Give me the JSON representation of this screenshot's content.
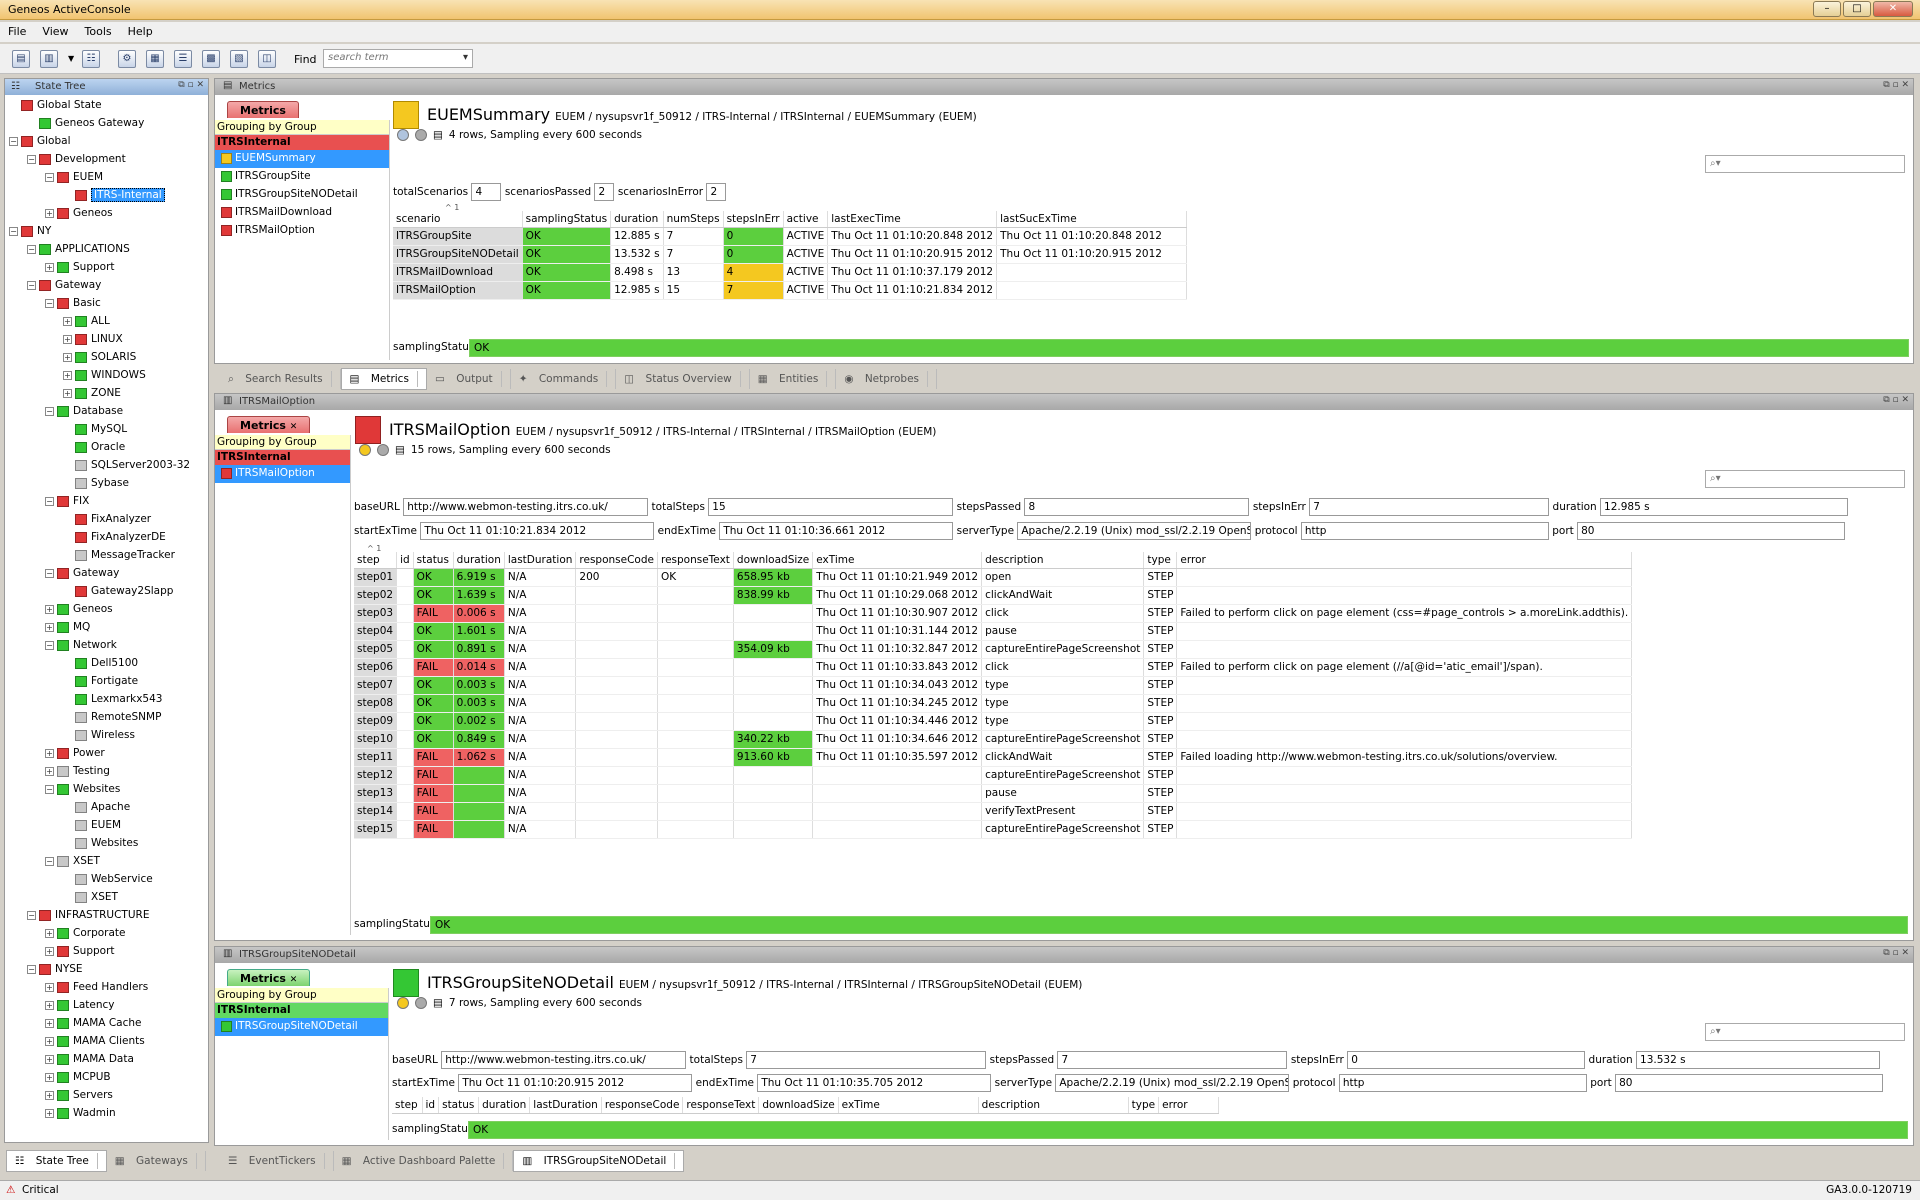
{
  "window": {
    "title": "Geneos ActiveConsole",
    "controls": [
      "–",
      "□",
      "✕"
    ]
  },
  "menu": [
    "File",
    "View",
    "Tools",
    "Help"
  ],
  "toolbar": {
    "find_label": "Find",
    "search_placeholder": "search term"
  },
  "state_tree": {
    "title": "State Tree",
    "nodes": [
      {
        "label": "Global State",
        "level": 0,
        "color": "r",
        "expand": ""
      },
      {
        "label": "Geneos Gateway",
        "level": 1,
        "color": "g",
        "expand": ""
      },
      {
        "label": "Global",
        "level": 0,
        "color": "r",
        "expand": "−"
      },
      {
        "label": "Development",
        "level": 1,
        "color": "r",
        "expand": "−"
      },
      {
        "label": "EUEM",
        "level": 2,
        "color": "r",
        "expand": "−"
      },
      {
        "label": "ITRS-Internal",
        "level": 3,
        "color": "r",
        "expand": "",
        "selected": true
      },
      {
        "label": "Geneos",
        "level": 2,
        "color": "r",
        "expand": "+"
      },
      {
        "label": "NY",
        "level": 0,
        "color": "r",
        "expand": "−"
      },
      {
        "label": "APPLICATIONS",
        "level": 1,
        "color": "g",
        "expand": "−"
      },
      {
        "label": "Support",
        "level": 2,
        "color": "g",
        "expand": "+"
      },
      {
        "label": "Gateway",
        "level": 1,
        "color": "r",
        "expand": "−"
      },
      {
        "label": "Basic",
        "level": 2,
        "color": "r",
        "expand": "−"
      },
      {
        "label": "ALL",
        "level": 3,
        "color": "g",
        "expand": "+"
      },
      {
        "label": "LINUX",
        "level": 3,
        "color": "r",
        "expand": "+"
      },
      {
        "label": "SOLARIS",
        "level": 3,
        "color": "g",
        "expand": "+"
      },
      {
        "label": "WINDOWS",
        "level": 3,
        "color": "g",
        "expand": "+"
      },
      {
        "label": "ZONE",
        "level": 3,
        "color": "g",
        "expand": "+"
      },
      {
        "label": "Database",
        "level": 2,
        "color": "g",
        "expand": "−"
      },
      {
        "label": "MySQL",
        "level": 3,
        "color": "g",
        "expand": ""
      },
      {
        "label": "Oracle",
        "level": 3,
        "color": "g",
        "expand": ""
      },
      {
        "label": "SQLServer2003-32",
        "level": 3,
        "color": "gr",
        "expand": ""
      },
      {
        "label": "Sybase",
        "level": 3,
        "color": "gr",
        "expand": ""
      },
      {
        "label": "FIX",
        "level": 2,
        "color": "r",
        "expand": "−"
      },
      {
        "label": "FixAnalyzer",
        "level": 3,
        "color": "r",
        "expand": ""
      },
      {
        "label": "FixAnalyzerDE",
        "level": 3,
        "color": "r",
        "expand": ""
      },
      {
        "label": "MessageTracker",
        "level": 3,
        "color": "gr",
        "expand": ""
      },
      {
        "label": "Gateway",
        "level": 2,
        "color": "r",
        "expand": "−"
      },
      {
        "label": "Gateway2Slapp",
        "level": 3,
        "color": "r",
        "expand": ""
      },
      {
        "label": "Geneos",
        "level": 2,
        "color": "g",
        "expand": "+"
      },
      {
        "label": "MQ",
        "level": 2,
        "color": "g",
        "expand": "+"
      },
      {
        "label": "Network",
        "level": 2,
        "color": "g",
        "expand": "−"
      },
      {
        "label": "Dell5100",
        "level": 3,
        "color": "g",
        "expand": ""
      },
      {
        "label": "Fortigate",
        "level": 3,
        "color": "g",
        "expand": ""
      },
      {
        "label": "Lexmarkx543",
        "level": 3,
        "color": "g",
        "expand": ""
      },
      {
        "label": "RemoteSNMP",
        "level": 3,
        "color": "gr",
        "expand": ""
      },
      {
        "label": "Wireless",
        "level": 3,
        "color": "gr",
        "expand": ""
      },
      {
        "label": "Power",
        "level": 2,
        "color": "r",
        "expand": "+"
      },
      {
        "label": "Testing",
        "level": 2,
        "color": "gr",
        "expand": "+"
      },
      {
        "label": "Websites",
        "level": 2,
        "color": "g",
        "expand": "−"
      },
      {
        "label": "Apache",
        "level": 3,
        "color": "gr",
        "expand": ""
      },
      {
        "label": "EUEM",
        "level": 3,
        "color": "gr",
        "expand": ""
      },
      {
        "label": "Websites",
        "level": 3,
        "color": "gr",
        "expand": ""
      },
      {
        "label": "XSET",
        "level": 2,
        "color": "gr",
        "expand": "−"
      },
      {
        "label": "WebService",
        "level": 3,
        "color": "gr",
        "expand": ""
      },
      {
        "label": "XSET",
        "level": 3,
        "color": "gr",
        "expand": ""
      },
      {
        "label": "INFRASTRUCTURE",
        "level": 1,
        "color": "r",
        "expand": "−"
      },
      {
        "label": "Corporate",
        "level": 2,
        "color": "g",
        "expand": "+"
      },
      {
        "label": "Support",
        "level": 2,
        "color": "r",
        "expand": "+"
      },
      {
        "label": "NYSE",
        "level": 1,
        "color": "r",
        "expand": "−"
      },
      {
        "label": "Feed Handlers",
        "level": 2,
        "color": "r",
        "expand": "+"
      },
      {
        "label": "Latency",
        "level": 2,
        "color": "g",
        "expand": "+"
      },
      {
        "label": "MAMA Cache",
        "level": 2,
        "color": "g",
        "expand": "+"
      },
      {
        "label": "MAMA Clients",
        "level": 2,
        "color": "g",
        "expand": "+"
      },
      {
        "label": "MAMA Data",
        "level": 2,
        "color": "g",
        "expand": "+"
      },
      {
        "label": "MCPUB",
        "level": 2,
        "color": "g",
        "expand": "+"
      },
      {
        "label": "Servers",
        "level": 2,
        "color": "g",
        "expand": "+"
      },
      {
        "label": "Wadmin",
        "level": 2,
        "color": "g",
        "expand": "+"
      }
    ],
    "bottom_tabs": [
      "State Tree",
      "Gateways"
    ]
  },
  "metrics_panel": {
    "title": "Metrics",
    "tab": "Metrics",
    "grouping": {
      "header": "Grouping by Group",
      "category": "ITRSInternal",
      "items": [
        "EUEMSummary",
        "ITRSGroupSite",
        "ITRSGroupSiteNODetail",
        "ITRSMailDownload",
        "ITRSMailOption"
      ]
    },
    "dataview": {
      "name": "EUEMSummary",
      "path": "EUEM / nysupsvr1f_50912 / ITRS-Internal / ITRSInternal / EUEMSummary (EUEM)",
      "info": "4 rows, Sampling every 600 seconds"
    },
    "headlines": [
      {
        "label": "totalScenarios",
        "value": "4"
      },
      {
        "label": "scenariosPassed",
        "value": "2"
      },
      {
        "label": "scenariosInError",
        "value": "2"
      }
    ],
    "sort_indicator": "^ 1",
    "columns": [
      "scenario",
      "samplingStatus",
      "duration",
      "numSteps",
      "stepsInErr",
      "active",
      "lastExecTime",
      "lastSucExTime"
    ],
    "rows": [
      [
        "ITRSGroupSite",
        "OK",
        "12.885 s",
        "7",
        "0",
        "ACTIVE",
        "Thu Oct 11 01:10:20.848 2012",
        "Thu Oct 11 01:10:20.848 2012"
      ],
      [
        "ITRSGroupSiteNODetail",
        "OK",
        "13.532 s",
        "7",
        "0",
        "ACTIVE",
        "Thu Oct 11 01:10:20.915 2012",
        "Thu Oct 11 01:10:20.915 2012"
      ],
      [
        "ITRSMailDownload",
        "OK",
        "8.498 s",
        "13",
        "4",
        "ACTIVE",
        "Thu Oct 11 01:10:37.179 2012",
        ""
      ],
      [
        "ITRSMailOption",
        "OK",
        "12.985 s",
        "15",
        "7",
        "ACTIVE",
        "Thu Oct 11 01:10:21.834 2012",
        ""
      ]
    ],
    "sampling_label": "samplingStatus",
    "sampling_value": "OK"
  },
  "middle_tabs": [
    "Search Results",
    "Metrics",
    "Output",
    "Commands",
    "Status Overview",
    "Entities",
    "Netprobes"
  ],
  "mail_panel": {
    "title": "ITRSMailOption",
    "tab": "Metrics",
    "grouping": {
      "header": "Grouping by Group",
      "category": "ITRSInternal",
      "items": [
        "ITRSMailOption"
      ]
    },
    "dataview": {
      "name": "ITRSMailOption",
      "path": "EUEM / nysupsvr1f_50912 / ITRS-Internal / ITRSInternal / ITRSMailOption (EUEM)",
      "info": "15 rows, Sampling every 600 seconds"
    },
    "headlines": {
      "baseURL": "http://www.webmon-testing.itrs.co.uk/",
      "totalSteps": "15",
      "stepsPassed": "8",
      "stepsInErr": "7",
      "duration": "12.985 s",
      "startExTime": "Thu Oct 11 01:10:21.834 2012",
      "endExTime": "Thu Oct 11 01:10:36.661 2012",
      "serverType": "Apache/2.2.19 (Unix) mod_ssl/2.2.19 OpenS...",
      "protocol": "http",
      "port": "80"
    },
    "sort_indicator": "^ 1",
    "columns": [
      "step",
      "id",
      "status",
      "duration",
      "lastDuration",
      "responseCode",
      "responseText",
      "downloadSize",
      "exTime",
      "description",
      "type",
      "error"
    ],
    "rows": [
      [
        "step01",
        "",
        "OK",
        "6.919 s",
        "N/A",
        "200",
        "OK",
        "658.95 kb",
        "Thu Oct 11 01:10:21.949 2012",
        "open",
        "STEP",
        ""
      ],
      [
        "step02",
        "",
        "OK",
        "1.639 s",
        "N/A",
        "",
        "",
        "838.99 kb",
        "Thu Oct 11 01:10:29.068 2012",
        "clickAndWait",
        "STEP",
        ""
      ],
      [
        "step03",
        "",
        "FAIL",
        "0.006 s",
        "N/A",
        "",
        "",
        "",
        "Thu Oct 11 01:10:30.907 2012",
        "click",
        "STEP",
        "Failed to perform click on page element (css=#page_controls > a.moreLink.addthis)."
      ],
      [
        "step04",
        "",
        "OK",
        "1.601 s",
        "N/A",
        "",
        "",
        "",
        "Thu Oct 11 01:10:31.144 2012",
        "pause",
        "STEP",
        ""
      ],
      [
        "step05",
        "",
        "OK",
        "0.891 s",
        "N/A",
        "",
        "",
        "354.09 kb",
        "Thu Oct 11 01:10:32.847 2012",
        "captureEntirePageScreenshot",
        "STEP",
        ""
      ],
      [
        "step06",
        "",
        "FAIL",
        "0.014 s",
        "N/A",
        "",
        "",
        "",
        "Thu Oct 11 01:10:33.843 2012",
        "click",
        "STEP",
        "Failed to perform click on page element (//a[@id='atic_email']/span)."
      ],
      [
        "step07",
        "",
        "OK",
        "0.003 s",
        "N/A",
        "",
        "",
        "",
        "Thu Oct 11 01:10:34.043 2012",
        "type",
        "STEP",
        ""
      ],
      [
        "step08",
        "",
        "OK",
        "0.003 s",
        "N/A",
        "",
        "",
        "",
        "Thu Oct 11 01:10:34.245 2012",
        "type",
        "STEP",
        ""
      ],
      [
        "step09",
        "",
        "OK",
        "0.002 s",
        "N/A",
        "",
        "",
        "",
        "Thu Oct 11 01:10:34.446 2012",
        "type",
        "STEP",
        ""
      ],
      [
        "step10",
        "",
        "OK",
        "0.849 s",
        "N/A",
        "",
        "",
        "340.22 kb",
        "Thu Oct 11 01:10:34.646 2012",
        "captureEntirePageScreenshot",
        "STEP",
        ""
      ],
      [
        "step11",
        "",
        "FAIL",
        "1.062 s",
        "N/A",
        "",
        "",
        "913.60 kb",
        "Thu Oct 11 01:10:35.597 2012",
        "clickAndWait",
        "STEP",
        "Failed loading http://www.webmon-testing.itrs.co.uk/solutions/overview."
      ],
      [
        "step12",
        "",
        "FAIL",
        "",
        "N/A",
        "",
        "",
        "",
        "",
        "captureEntirePageScreenshot",
        "STEP",
        ""
      ],
      [
        "step13",
        "",
        "FAIL",
        "",
        "N/A",
        "",
        "",
        "",
        "",
        "pause",
        "STEP",
        ""
      ],
      [
        "step14",
        "",
        "FAIL",
        "",
        "N/A",
        "",
        "",
        "",
        "",
        "verifyTextPresent",
        "STEP",
        ""
      ],
      [
        "step15",
        "",
        "FAIL",
        "",
        "N/A",
        "",
        "",
        "",
        "",
        "captureEntirePageScreenshot",
        "STEP",
        ""
      ]
    ],
    "sampling_label": "samplingStatus",
    "sampling_value": "OK"
  },
  "site_panel": {
    "title": "ITRSGroupSiteNODetail",
    "tab": "Metrics",
    "grouping": {
      "header": "Grouping by Group",
      "category": "ITRSInternal",
      "items": [
        "ITRSGroupSiteNODetail"
      ]
    },
    "dataview": {
      "name": "ITRSGroupSiteNODetail",
      "path": "EUEM / nysupsvr1f_50912 / ITRS-Internal / ITRSInternal / ITRSGroupSiteNODetail (EUEM)",
      "info": "7 rows, Sampling every 600 seconds"
    },
    "headlines": {
      "baseURL": "http://www.webmon-testing.itrs.co.uk/",
      "totalSteps": "7",
      "stepsPassed": "7",
      "stepsInErr": "0",
      "duration": "13.532 s",
      "startExTime": "Thu Oct 11 01:10:20.915 2012",
      "endExTime": "Thu Oct 11 01:10:35.705 2012",
      "serverType": "Apache/2.2.19 (Unix) mod_ssl/2.2.19 OpenS...",
      "protocol": "http",
      "port": "80"
    },
    "columns": [
      "step",
      "id",
      "status",
      "duration",
      "lastDuration",
      "responseCode",
      "responseText",
      "downloadSize",
      "exTime",
      "description",
      "type",
      "error"
    ],
    "sampling_label": "samplingStatus",
    "sampling_value": "OK"
  },
  "bottom_tabs": [
    "EventTickers",
    "Active Dashboard Palette",
    "ITRSGroupSiteNODetail"
  ],
  "statusbar": {
    "left": "Critical",
    "right": "GA3.0.0-120719"
  }
}
